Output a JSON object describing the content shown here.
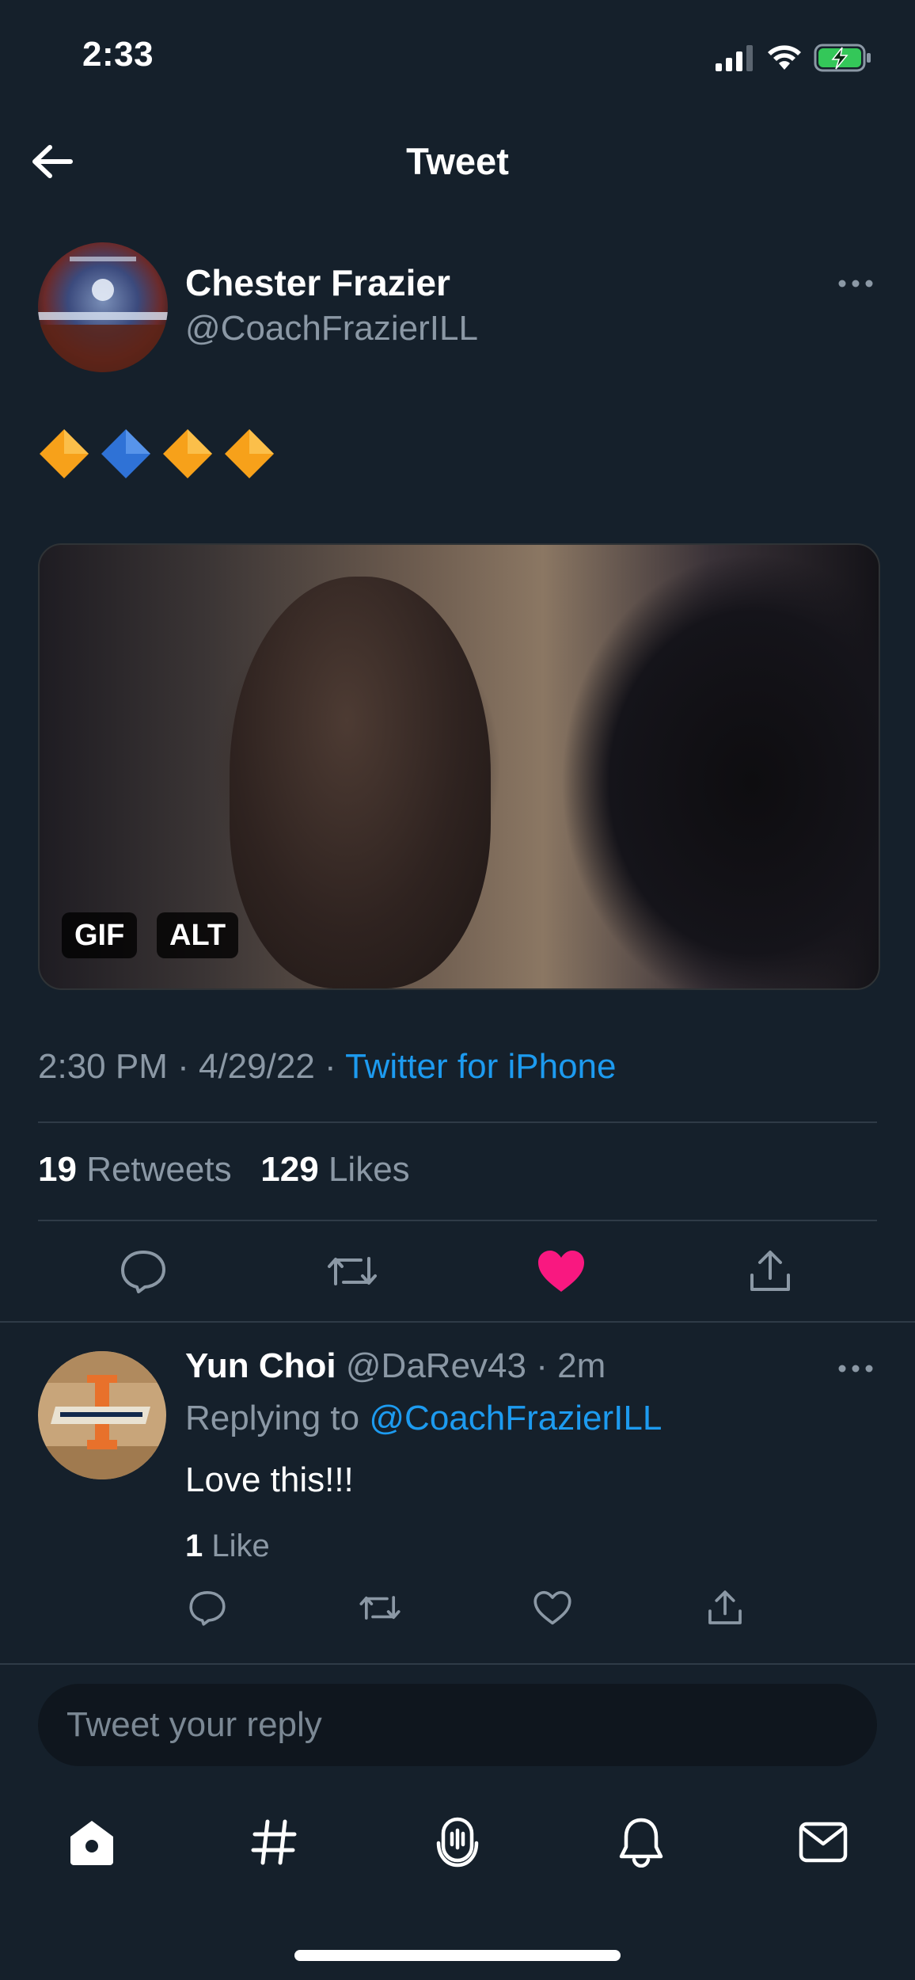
{
  "status_bar": {
    "time": "2:33"
  },
  "nav": {
    "title": "Tweet"
  },
  "tweet": {
    "author_name": "Chester Frazier",
    "author_handle": "@CoachFrazierILL",
    "emojis": [
      "orange-diamond",
      "blue-diamond",
      "orange-diamond",
      "orange-diamond"
    ],
    "media": {
      "badge_gif": "GIF",
      "badge_alt": "ALT"
    },
    "time": "2:30 PM",
    "date": "4/29/22",
    "source": "Twitter for iPhone",
    "retweets_count": "19",
    "retweets_label": "Retweets",
    "likes_count": "129",
    "likes_label": "Likes",
    "liked": true
  },
  "reply": {
    "author_name": "Yun Choi",
    "author_handle": "@DaRev43",
    "age": "2m",
    "replying_to_label": "Replying to",
    "replying_to_handle": "@CoachFrazierILL",
    "text": "Love this!!!",
    "likes_count": "1",
    "likes_label": "Like"
  },
  "compose": {
    "placeholder": "Tweet your reply"
  },
  "colors": {
    "background": "#15202b",
    "accent": "#1d9bf0",
    "like": "#f91880",
    "muted": "#8b98a5",
    "battery": "#34c759"
  }
}
